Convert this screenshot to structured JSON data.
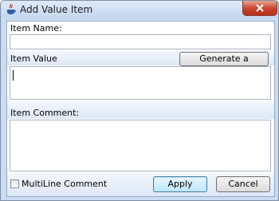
{
  "window": {
    "title": "Add Value Item",
    "close_icon": "close-icon",
    "app_icon": "java-cup-icon"
  },
  "form": {
    "item_name_label": "Item Name:",
    "item_name_value": "",
    "item_value_label": "Item Value",
    "item_value_value": "",
    "generate_password_label": "Generate a Password",
    "item_comment_label": "Item Comment:",
    "item_comment_value": "",
    "multiline_label": "MultiLine Comment",
    "multiline_checked": false
  },
  "buttons": {
    "apply": "Apply",
    "cancel": "Cancel"
  },
  "colors": {
    "titlebar": "#c9dcf1",
    "close_button": "#c7432b",
    "apply_button": "#bee6fd"
  }
}
